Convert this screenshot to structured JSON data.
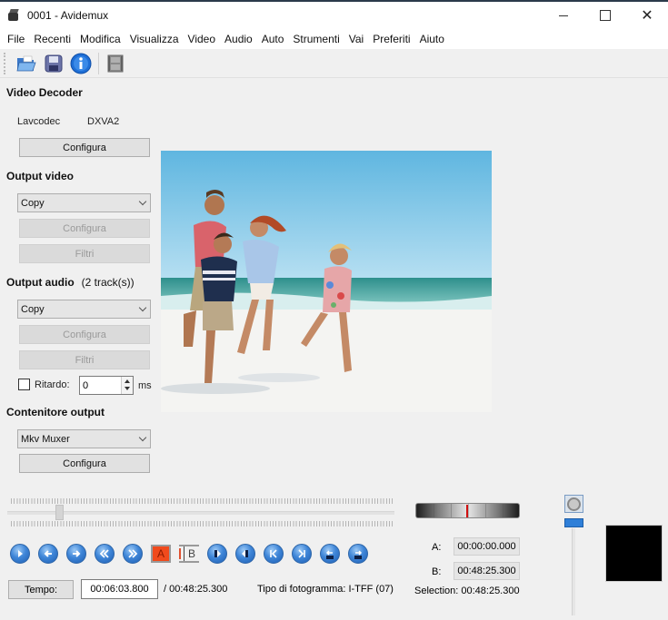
{
  "window": {
    "title": "0001 - Avidemux",
    "controls": {
      "minimize": "minimize",
      "maximize": "maximize",
      "close": "✕"
    }
  },
  "menu": [
    "File",
    "Recenti",
    "Modifica",
    "Visualizza",
    "Video",
    "Audio",
    "Auto",
    "Strumenti",
    "Vai",
    "Preferiti",
    "Aiuto"
  ],
  "toolbar": {
    "icons": [
      "open-folder-icon",
      "save-disk-icon",
      "info-icon",
      "film-properties-icon"
    ]
  },
  "video_decoder": {
    "title": "Video Decoder",
    "decoder_name": "Lavcodec",
    "hw_accel": "DXVA2",
    "configure_label": "Configura"
  },
  "output_video": {
    "title": "Output video",
    "codec": "Copy",
    "configure_label": "Configura",
    "filters_label": "Filtri"
  },
  "output_audio": {
    "title": "Output audio",
    "tracks": "(2 track(s))",
    "codec": "Copy",
    "configure_label": "Configura",
    "filters_label": "Filtri",
    "delay_label": "Ritardo:",
    "delay_checked": false,
    "delay_value": "0",
    "delay_unit": "ms"
  },
  "container": {
    "title": "Contenitore output",
    "muxer": "Mkv Muxer",
    "configure_label": "Configura"
  },
  "timeline": {
    "position_fraction": 0.125
  },
  "playback_buttons": [
    "play",
    "previous-frame",
    "next-frame",
    "previous-keyframe",
    "next-keyframe",
    "set-marker-a",
    "set-marker-b",
    "previous-cut-point",
    "next-cut-point",
    "go-to-marker-a",
    "go-to-marker-b",
    "back-60s",
    "forward-60s"
  ],
  "ab_labels": {
    "a": "A",
    "b": "B"
  },
  "time": {
    "tempo_label": "Tempo:",
    "current": "00:06:03.800",
    "total": "/ 00:48:25.300",
    "frame_type": "Tipo di fotogramma:  I-TFF (07)"
  },
  "markers": {
    "a_label": "A:",
    "a_value": "00:00:00.000",
    "b_label": "B:",
    "b_value": "00:48:25.300",
    "selection": "Selection: 00:48:25.300"
  },
  "colors": {
    "accent_blue": "#2f7fd8",
    "marker_a": "#f04a1c",
    "jog_marker": "#d01010"
  }
}
